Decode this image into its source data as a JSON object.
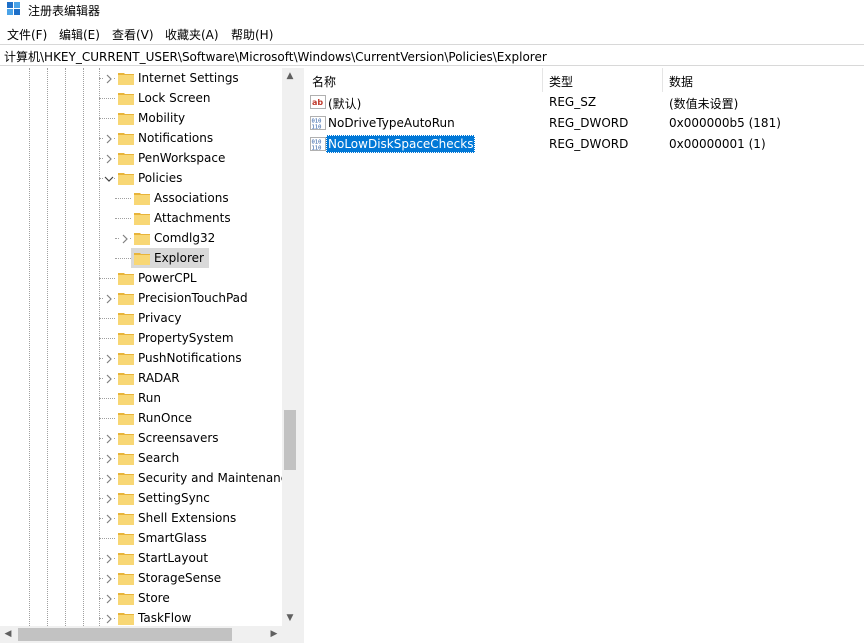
{
  "window": {
    "title": "注册表编辑器"
  },
  "menu": [
    {
      "label": "文件(F)"
    },
    {
      "label": "编辑(E)"
    },
    {
      "label": "查看(V)"
    },
    {
      "label": "收藏夹(A)"
    },
    {
      "label": "帮助(H)"
    }
  ],
  "address": {
    "path": "计算机\\HKEY_CURRENT_USER\\Software\\Microsoft\\Windows\\CurrentVersion\\Policies\\Explorer"
  },
  "tree": [
    {
      "label": "Internet Settings",
      "level": 0,
      "expander": "collapsed"
    },
    {
      "label": "Lock Screen",
      "level": 0,
      "expander": "none"
    },
    {
      "label": "Mobility",
      "level": 0,
      "expander": "none"
    },
    {
      "label": "Notifications",
      "level": 0,
      "expander": "collapsed"
    },
    {
      "label": "PenWorkspace",
      "level": 0,
      "expander": "collapsed"
    },
    {
      "label": "Policies",
      "level": 0,
      "expander": "expanded"
    },
    {
      "label": "Associations",
      "level": 1,
      "expander": "none"
    },
    {
      "label": "Attachments",
      "level": 1,
      "expander": "none"
    },
    {
      "label": "Comdlg32",
      "level": 1,
      "expander": "collapsed"
    },
    {
      "label": "Explorer",
      "level": 1,
      "expander": "none",
      "selected": true
    },
    {
      "label": "PowerCPL",
      "level": 0,
      "expander": "none"
    },
    {
      "label": "PrecisionTouchPad",
      "level": 0,
      "expander": "collapsed"
    },
    {
      "label": "Privacy",
      "level": 0,
      "expander": "none"
    },
    {
      "label": "PropertySystem",
      "level": 0,
      "expander": "none"
    },
    {
      "label": "PushNotifications",
      "level": 0,
      "expander": "collapsed"
    },
    {
      "label": "RADAR",
      "level": 0,
      "expander": "collapsed"
    },
    {
      "label": "Run",
      "level": 0,
      "expander": "none"
    },
    {
      "label": "RunOnce",
      "level": 0,
      "expander": "none"
    },
    {
      "label": "Screensavers",
      "level": 0,
      "expander": "collapsed"
    },
    {
      "label": "Search",
      "level": 0,
      "expander": "collapsed"
    },
    {
      "label": "Security and Maintenance",
      "level": 0,
      "expander": "collapsed"
    },
    {
      "label": "SettingSync",
      "level": 0,
      "expander": "collapsed"
    },
    {
      "label": "Shell Extensions",
      "level": 0,
      "expander": "collapsed"
    },
    {
      "label": "SmartGlass",
      "level": 0,
      "expander": "none"
    },
    {
      "label": "StartLayout",
      "level": 0,
      "expander": "collapsed"
    },
    {
      "label": "StorageSense",
      "level": 0,
      "expander": "collapsed"
    },
    {
      "label": "Store",
      "level": 0,
      "expander": "collapsed"
    },
    {
      "label": "TaskFlow",
      "level": 0,
      "expander": "collapsed"
    }
  ],
  "list": {
    "columns": {
      "name": "名称",
      "type": "类型",
      "data": "数据"
    },
    "rows": [
      {
        "name": "(默认)",
        "type": "REG_SZ",
        "data": "(数值未设置)",
        "icon": "string-value-icon"
      },
      {
        "name": "NoDriveTypeAutoRun",
        "type": "REG_DWORD",
        "data": "0x000000b5 (181)",
        "icon": "binary-value-icon"
      },
      {
        "name": "NoLowDiskSpaceChecks",
        "type": "REG_DWORD",
        "data": "0x00000001 (1)",
        "icon": "binary-value-icon",
        "selected": true
      }
    ]
  },
  "colors": {
    "selection": "#0078d7",
    "folder": "#f5c242",
    "tree_selection": "#d9d9d9"
  }
}
